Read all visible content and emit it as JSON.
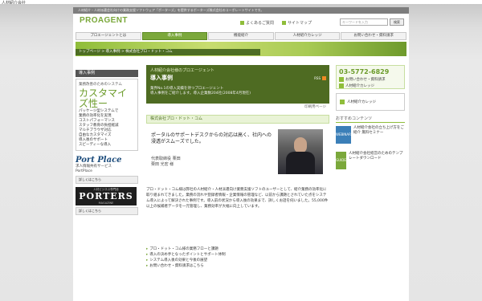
{
  "top_line": "人材紹介会社",
  "announcement": "人材紹介・人材派遣会社向けの業務支援ソフトウェア「ポーターズ」を提供するポーターズ株式会社のコーポレートサイトです。",
  "header": {
    "logo": "PROAGENT",
    "links": [
      "よくあるご質問",
      "サイトマップ"
    ],
    "search_placeholder": "キーワードを入力",
    "search_button": "検索"
  },
  "gnav": [
    "プロエージェントとは",
    "導入事例",
    "機能紹介",
    "人材紹介カレッジ",
    "お問い合わせ・資料請求"
  ],
  "breadcrumb": "トップページ > 導入事例 > 株式会社プロ・ドット・コム",
  "left": {
    "heading": "導入事例",
    "small": "業務改善のためのシステム",
    "title": "カスタマイズ性ー",
    "list": [
      "パッケージ型システムで",
      "業務の効率化を実現",
      "コストパフォーマンス",
      "スタッフ教育の負担軽減",
      "マルチブラウザ対応",
      "自由なカスタマイズ",
      "導入後のサポート",
      "スピーディーな導入"
    ],
    "portplace": "Port Place",
    "portplace_sub": [
      "求人情報共有サービス",
      "PortPlace"
    ],
    "portplace_link": "詳しくはこちら",
    "porters_top": "人材ビジネス専門誌",
    "porters": "PORTERS",
    "porters_sub": "MAGAZINE",
    "porters_link": "詳しくはこちら"
  },
  "hero": {
    "kicker": "人材紹介会社様のプロエージェント",
    "title": "導入事例",
    "desc1": "業界No.1の導入実績を持つプロエージェント",
    "desc2": "導入事例をご紹介します。導入企業数204社(2008年4月現在)",
    "rss": "RSS"
  },
  "print_label": "印刷用ページ",
  "case": {
    "head": "株式会社プロ・ドット・コム",
    "quote": "ポータルのサポートデスクからの対応は高く、社内への浸透がスムーズでした。",
    "name1": "代表取締役 栗田",
    "name2": "栗田 光宏 様",
    "body": "プロ・ドット・コム様は弊社の人材紹介・人材派遣向け業務支援ソフトのユーザーとして、紹介業務の効率化に取り組まれてきました。業務の流れや登録者情報・企業情報の管理など、以前から課題とされていた点をシステム導入によって解決された事例です。導入前の状況から導入後の効果まで、詳しくお話を伺いました。55,000件以上の候補者データを一元管理し、業務効率が大幅に向上しています。"
  },
  "links": [
    "プロ・ドット・コム様の業務フローと課題",
    "導入の決め手となったポイントとサポート体制",
    "システム導入後の効果と今後の展望",
    "お問い合わせ・資料請求はこちら"
  ],
  "right": {
    "phone": "03-5772-6829",
    "phone_links": [
      "お問い合わせ・資料請求",
      "人材紹介カレッジ"
    ],
    "college": "人材紹介カレッジ",
    "section": "おすすめコンテンツ",
    "cards": [
      {
        "thumb": "WEBINAR",
        "text": "人材紹介会社の立ち上げ方をご紹介 無料セミナー"
      },
      {
        "thumb": "GUIDE",
        "text": "人材紹介会社経営のためのテンプレートダウンロード"
      }
    ]
  },
  "colors": {
    "brand_green": "#7ba83b",
    "dark_green": "#4e6b22",
    "phone_green": "#6b9b2a"
  }
}
